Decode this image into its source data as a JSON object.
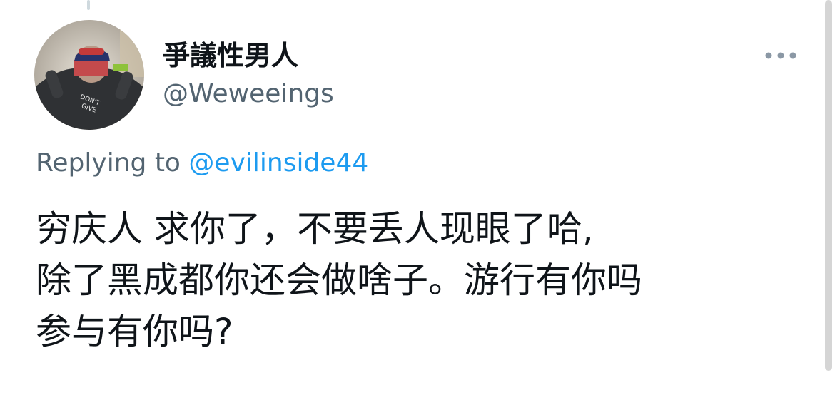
{
  "tweet": {
    "author": {
      "display_name": "爭議性男人",
      "handle": "@Weweeings",
      "avatar_icon": "user-avatar-photo"
    },
    "more_icon": "more-dots-icon",
    "replying_prefix": "Replying to",
    "replying_to": "@evilinside44",
    "body_lines": [
      "穷庆人 求你了，不要丢人现眼了哈,",
      "除了黑成都你还会做啥子。游行有你吗",
      "参与有你吗?"
    ]
  },
  "colors": {
    "primary_text": "#0f1419",
    "secondary_text": "#536471",
    "link": "#1d9bf0"
  }
}
